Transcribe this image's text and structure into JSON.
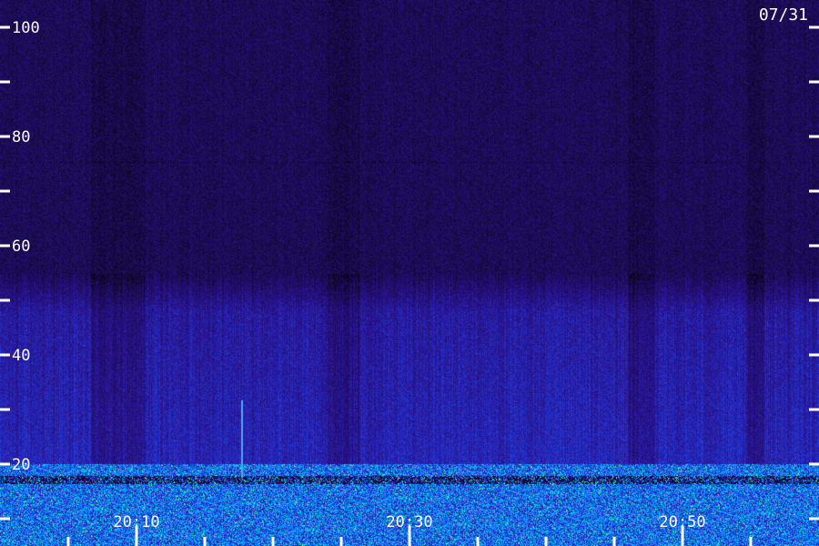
{
  "chart_data": {
    "type": "heatmap",
    "title": "",
    "xlabel": "",
    "ylabel": "",
    "date_label": "07/31",
    "y_tick_labels": [
      "20",
      "40",
      "60",
      "80",
      "100"
    ],
    "y_major_ticks": [
      20,
      40,
      60,
      80,
      100
    ],
    "y_minor_ticks": [
      10,
      30,
      50,
      70,
      90
    ],
    "ylim": [
      10,
      100
    ],
    "x_tick_labels": [
      "20:10",
      "20:30",
      "20:50"
    ],
    "x_major_ticks_minutes": [
      10,
      30,
      50
    ],
    "x_minor_ticks_minutes": [
      5,
      15,
      20,
      25,
      35,
      40,
      45,
      55
    ],
    "xlim_minutes": [
      5,
      60
    ],
    "colormap": [
      "#000000",
      "#1a0a4a",
      "#2a128e",
      "#2238d8",
      "#1f6cff",
      "#00b0ff",
      "#12f0c8",
      "#d8ff30"
    ],
    "intensity_profile": [
      {
        "freq_range": [
          10,
          20
        ],
        "level": "very high, green/cyan speckle"
      },
      {
        "freq_range": [
          20,
          55
        ],
        "level": "moderate, blue"
      },
      {
        "freq_range": [
          55,
          100
        ],
        "level": "low, dark purple"
      }
    ]
  }
}
